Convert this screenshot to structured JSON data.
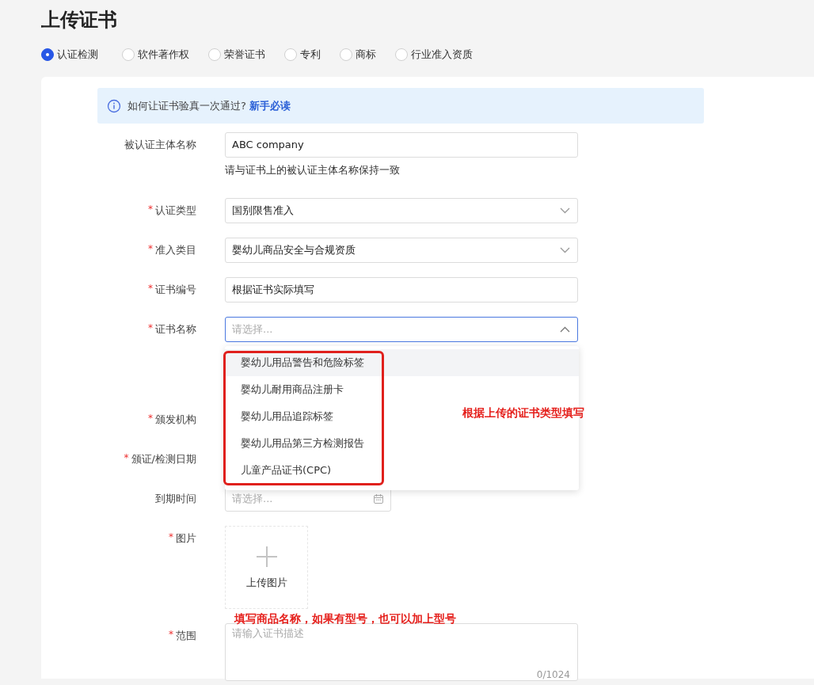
{
  "page": {
    "title": "上传证书"
  },
  "cert_types": [
    {
      "label": "认证检测",
      "selected": true
    },
    {
      "label": "软件著作权",
      "selected": false
    },
    {
      "label": "荣誉证书",
      "selected": false
    },
    {
      "label": "专利",
      "selected": false
    },
    {
      "label": "商标",
      "selected": false
    },
    {
      "label": "行业准入资质",
      "selected": false
    }
  ],
  "notice": {
    "text": "如何让证书验真一次通过?",
    "link": "新手必读"
  },
  "form": [
    {
      "kind": "input",
      "label": "被认证主体名称",
      "value": "ABC company",
      "hint": "请与证书上的被认证主体名称保持一致"
    },
    {
      "kind": "select",
      "mark": "*",
      "label": "认证类型",
      "value": "国别限售准入"
    },
    {
      "kind": "select",
      "mark": "*",
      "label": "准入类目",
      "value": "婴幼儿商品安全与合规资质"
    },
    {
      "kind": "input",
      "mark": "*",
      "label": "证书编号",
      "value": "根据证书实际填写"
    },
    {
      "kind": "select_open",
      "mark": "*",
      "label": "证书名称",
      "placeholder": "请选择...",
      "options": [
        {
          "label": "婴幼儿用品警告和危险标签",
          "active": true
        },
        {
          "label": "婴幼儿耐用商品注册卡",
          "active": false
        },
        {
          "label": "婴幼儿用品追踪标签",
          "active": false
        },
        {
          "label": "婴幼儿用品第三方检测报告",
          "active": false
        },
        {
          "label": "儿童产品证书(CPC)",
          "active": false
        }
      ]
    },
    {
      "kind": "covered",
      "mark": "*",
      "label": "颁发机构"
    },
    {
      "kind": "covered",
      "mark": "*",
      "label": "颁证/检测日期"
    },
    {
      "kind": "date",
      "label": "到期时间",
      "placeholder": "请选择..."
    },
    {
      "kind": "upload",
      "mark": "*",
      "label": "图片",
      "button": "上传图片"
    },
    {
      "kind": "textarea",
      "mark": "*",
      "label": "范围",
      "placeholder": "请输入证书描述",
      "counter": "0/1024"
    }
  ],
  "annotations": [
    {
      "kind": "box"
    },
    {
      "kind": "sidenote",
      "text": "根据上传的证书类型填写"
    },
    {
      "kind": "overnote",
      "text": "填写商品名称，如果有型号，也可以加上型号"
    }
  ]
}
